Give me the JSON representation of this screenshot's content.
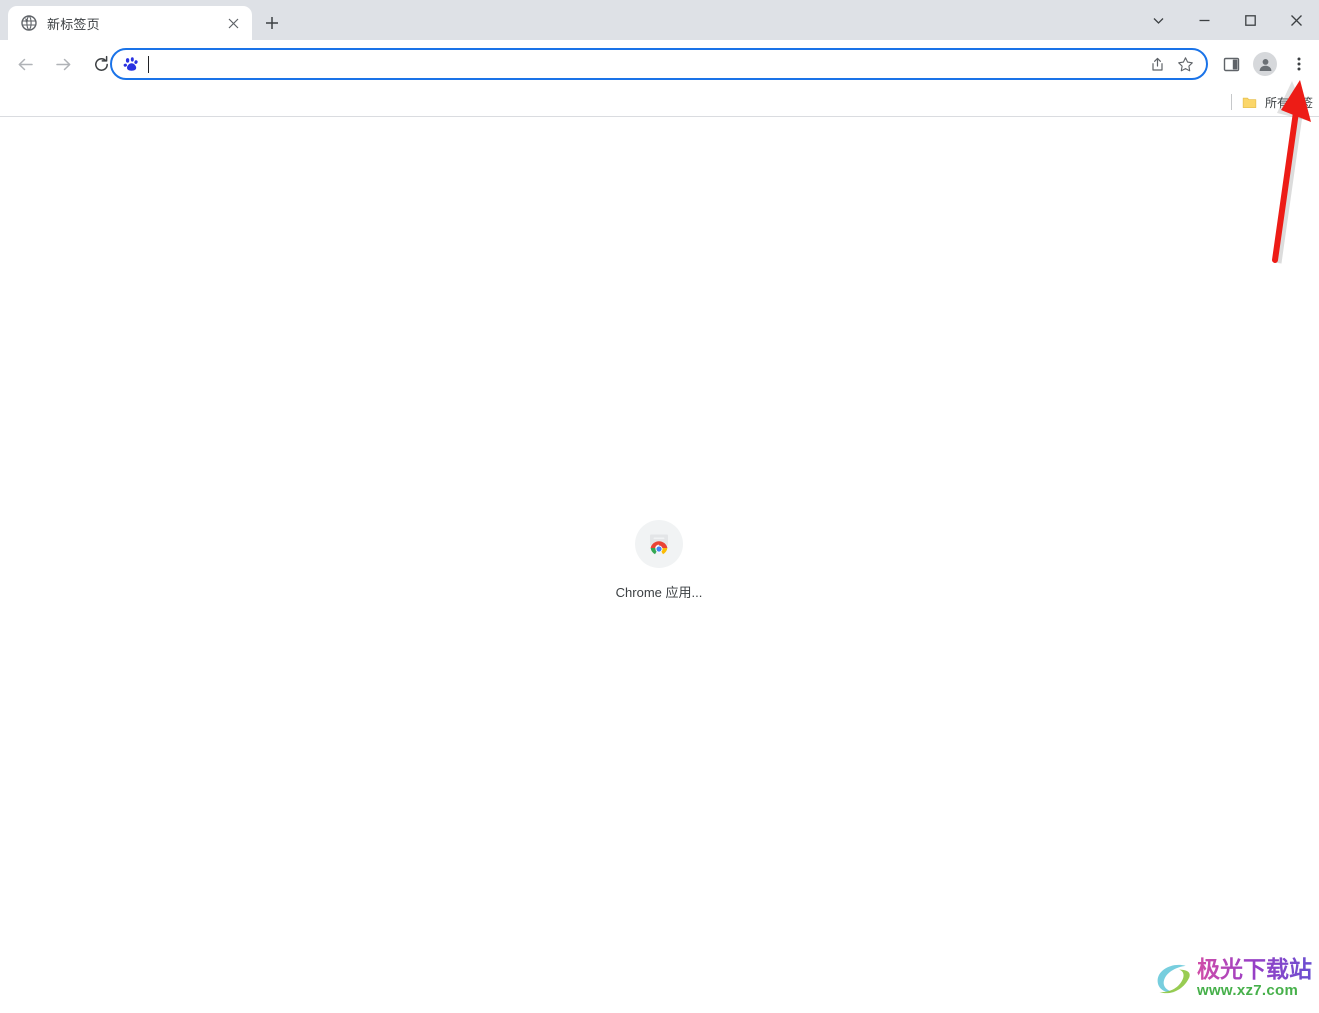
{
  "window": {
    "caption_buttons": [
      {
        "name": "tab-search",
        "glyph": "chevron-down"
      },
      {
        "name": "minimize",
        "glyph": "dash"
      },
      {
        "name": "maximize",
        "glyph": "square"
      },
      {
        "name": "close",
        "glyph": "cross"
      }
    ]
  },
  "tab_strip": {
    "active_tab": {
      "title": "新标签页",
      "favicon": "globe-icon",
      "close_label": "×"
    },
    "new_tab_label": "+"
  },
  "toolbar": {
    "back_label": "后退",
    "forward_label": "前进",
    "reload_label": "重新加载",
    "omnibox": {
      "value": "",
      "placeholder": "",
      "site_icon": "baidu-paw-icon",
      "share_label": "分享",
      "bookmark_label": "将此标签页加入书签"
    },
    "side_panel_label": "侧边栏",
    "profile_label": "个人资料",
    "menu_label": "自定义及控制 Google Chrome"
  },
  "bookmark_bar": {
    "all_bookmarks_label": "所有书签",
    "folder_icon": "folder-icon"
  },
  "page": {
    "apps_shortcut": {
      "label": "Chrome 应用...",
      "icon": "chrome-apps-icon"
    }
  },
  "annotation": {
    "arrow_color": "#ed1c16",
    "points_to": "chrome-menu-button"
  },
  "watermark": {
    "title": "极光下载站",
    "url": "www.xz7.com"
  },
  "colors": {
    "accent": "#1a73e8",
    "tabstrip_bg": "#dee1e6",
    "text": "#3c4043",
    "baidu_blue": "#2932e1",
    "annotation_red": "#ed1c16",
    "watermark_green": "#46b04a"
  }
}
